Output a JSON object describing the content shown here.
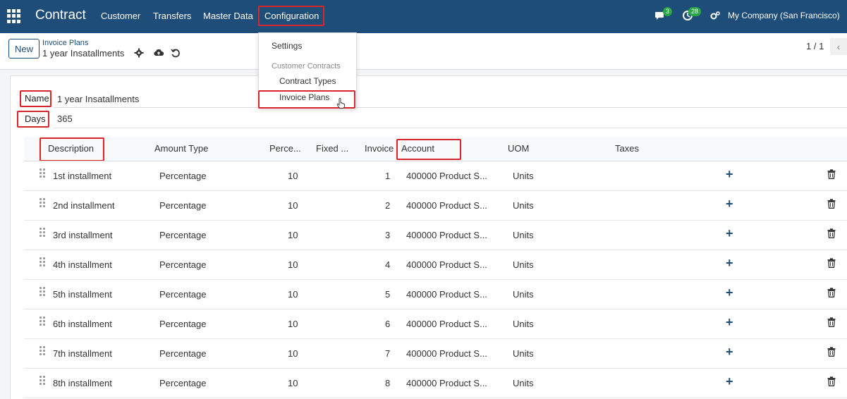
{
  "navbar": {
    "brand": "Contract",
    "menu": [
      {
        "label": "Customer"
      },
      {
        "label": "Transfers"
      },
      {
        "label": "Master Data"
      },
      {
        "label": "Configuration"
      }
    ],
    "messages_count": "3",
    "activities_count": "28",
    "company": "My Company (San Francisco)"
  },
  "control_panel": {
    "new_label": "New",
    "breadcrumb_parent": "Invoice Plans",
    "breadcrumb_current": "1 year Insatallments",
    "pager": "1 / 1"
  },
  "dropdown": {
    "settings": "Settings",
    "section_header": "Customer Contracts",
    "contract_types": "Contract Types",
    "invoice_plans": "Invoice Plans"
  },
  "form": {
    "name_label": "Name",
    "name_value": "1 year Insatallments",
    "days_label": "Days",
    "days_value": "365"
  },
  "table": {
    "columns": {
      "description": "Description",
      "amount_type": "Amount Type",
      "percentage": "Perce...",
      "fixed": "Fixed ...",
      "invoice": "Invoice",
      "account": "Account",
      "uom": "UOM",
      "taxes": "Taxes"
    },
    "rows": [
      {
        "description": "1st installment",
        "amount_type": "Percentage",
        "percentage": "10",
        "invoice": "1",
        "account": "400000 Product S...",
        "uom": "Units"
      },
      {
        "description": "2nd installment",
        "amount_type": "Percentage",
        "percentage": "10",
        "invoice": "2",
        "account": "400000 Product S...",
        "uom": "Units"
      },
      {
        "description": "3rd installment",
        "amount_type": "Percentage",
        "percentage": "10",
        "invoice": "3",
        "account": "400000 Product S...",
        "uom": "Units"
      },
      {
        "description": "4th installment",
        "amount_type": "Percentage",
        "percentage": "10",
        "invoice": "4",
        "account": "400000 Product S...",
        "uom": "Units"
      },
      {
        "description": "5th installment",
        "amount_type": "Percentage",
        "percentage": "10",
        "invoice": "5",
        "account": "400000 Product S...",
        "uom": "Units"
      },
      {
        "description": "6th installment",
        "amount_type": "Percentage",
        "percentage": "10",
        "invoice": "6",
        "account": "400000 Product S...",
        "uom": "Units"
      },
      {
        "description": "7th installment",
        "amount_type": "Percentage",
        "percentage": "10",
        "invoice": "7",
        "account": "400000 Product S...",
        "uom": "Units"
      },
      {
        "description": "8th installment",
        "amount_type": "Percentage",
        "percentage": "10",
        "invoice": "8",
        "account": "400000 Product S...",
        "uom": "Units"
      }
    ],
    "add_icon": "plus-icon",
    "delete_icon": "trash-icon"
  },
  "colors": {
    "navbar": "#1f4d7a",
    "highlight": "#d9262b",
    "badge": "#28a745"
  }
}
